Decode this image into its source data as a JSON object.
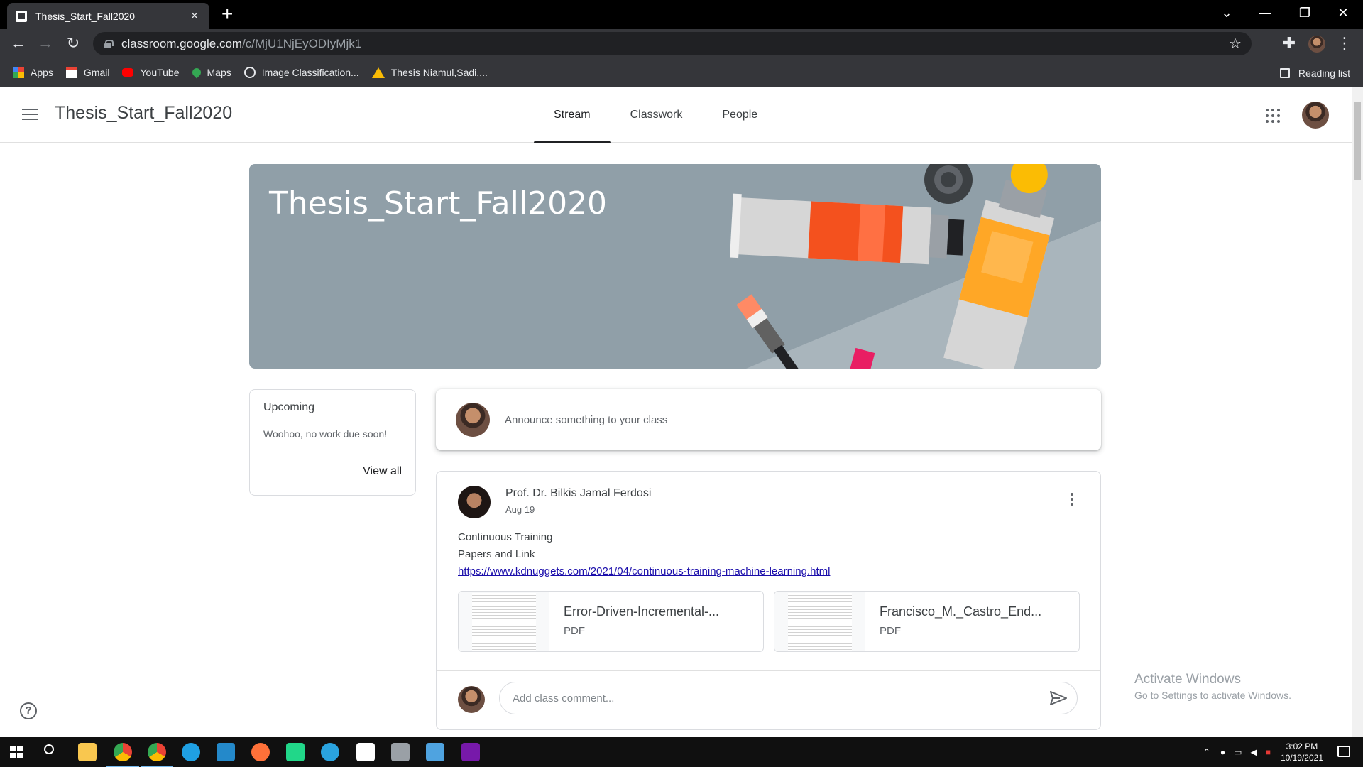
{
  "browser": {
    "tab_title": "Thesis_Start_Fall2020",
    "new_tab": "+",
    "url_host": "classroom.google.com",
    "url_path": "/c/MjU1NjEyODIyMjk1",
    "bookmarks": [
      "Apps",
      "Gmail",
      "YouTube",
      "Maps",
      "Image Classification...",
      "Thesis Niamul,Sadi,..."
    ],
    "reading_list": "Reading list"
  },
  "header": {
    "class_title": "Thesis_Start_Fall2020",
    "tabs": [
      "Stream",
      "Classwork",
      "People"
    ],
    "active_tab": "Stream"
  },
  "banner": {
    "title": "Thesis_Start_Fall2020"
  },
  "upcoming": {
    "title": "Upcoming",
    "message": "Woohoo, no work due soon!",
    "view_all": "View all"
  },
  "announce": {
    "placeholder": "Announce something to your class"
  },
  "post": {
    "author": "Prof. Dr. Bilkis Jamal Ferdosi",
    "date": "Aug 19",
    "lines": [
      "Continuous Training",
      "Papers and Link"
    ],
    "link": "https://www.kdnuggets.com/2021/04/continuous-training-machine-learning.html",
    "attachments": [
      {
        "name": "Error-Driven-Incremental-...",
        "type": "PDF"
      },
      {
        "name": "Francisco_M._Castro_End...",
        "type": "PDF"
      }
    ],
    "comment_placeholder": "Add class comment..."
  },
  "watermark": {
    "line1": "Activate Windows",
    "line2": "Go to Settings to activate Windows."
  },
  "taskbar": {
    "time": "3:02 PM",
    "date": "10/19/2021"
  },
  "colors": {
    "banner": "#909fa8",
    "link": "#1a0dab",
    "accent": "#202124"
  }
}
